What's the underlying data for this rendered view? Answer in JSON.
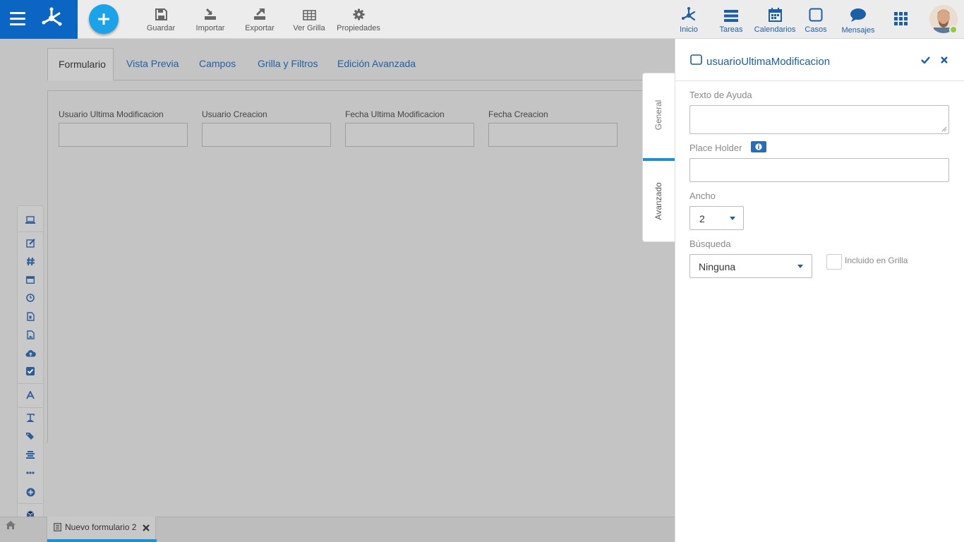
{
  "toolbar": {
    "save_label": "Guardar",
    "import_label": "Importar",
    "export_label": "Exportar",
    "grid_label": "Ver Grilla",
    "properties_label": "Propiedades"
  },
  "nav": {
    "home_label": "Inicio",
    "tasks_label": "Tareas",
    "calendars_label": "Calendarios",
    "cases_label": "Casos",
    "messages_label": "Mensajes"
  },
  "tabs": [
    {
      "label": "Formulario",
      "active": true
    },
    {
      "label": "Vista Previa",
      "active": false
    },
    {
      "label": "Campos",
      "active": false
    },
    {
      "label": "Grilla y Filtros",
      "active": false
    },
    {
      "label": "Edición Avanzada",
      "active": false
    }
  ],
  "form_fields": [
    {
      "label": "Usuario Ultima Modificacion",
      "value": ""
    },
    {
      "label": "Usuario Creacion",
      "value": ""
    },
    {
      "label": "Fecha Ultima Modificacion",
      "value": ""
    },
    {
      "label": "Fecha Creacion",
      "value": ""
    }
  ],
  "side_tabs": {
    "general_label": "General",
    "advanced_label": "Avanzado",
    "active": "Avanzado"
  },
  "panel": {
    "title": "usuarioUltimaModificacion",
    "help_text_label": "Texto de Ayuda",
    "help_text_value": "",
    "placeholder_label": "Place Holder",
    "placeholder_value": "",
    "width_label": "Ancho",
    "width_value": "2",
    "search_label": "Búsqueda",
    "search_value": "Ninguna",
    "included_in_grid_label": "Incluido en Grilla",
    "included_in_grid_checked": false
  },
  "bottom_tab": {
    "label": "Nuevo formulario 2"
  },
  "toolbox_icons": [
    "laptop-icon",
    "edit-icon",
    "hash-icon",
    "calendar-icon",
    "clock-icon",
    "file-icon",
    "image-icon",
    "cloud-upload-icon",
    "checkbox-icon",
    "font-icon",
    "text-icon",
    "tags-icon",
    "align-icon",
    "ellipsis-icon",
    "plus-circle-icon",
    "cube-icon",
    "list-icon"
  ],
  "colors": {
    "brand": "#0b66c3",
    "accent": "#1aa3e8",
    "link": "#1a5fa8",
    "online": "#8ccf3a"
  }
}
